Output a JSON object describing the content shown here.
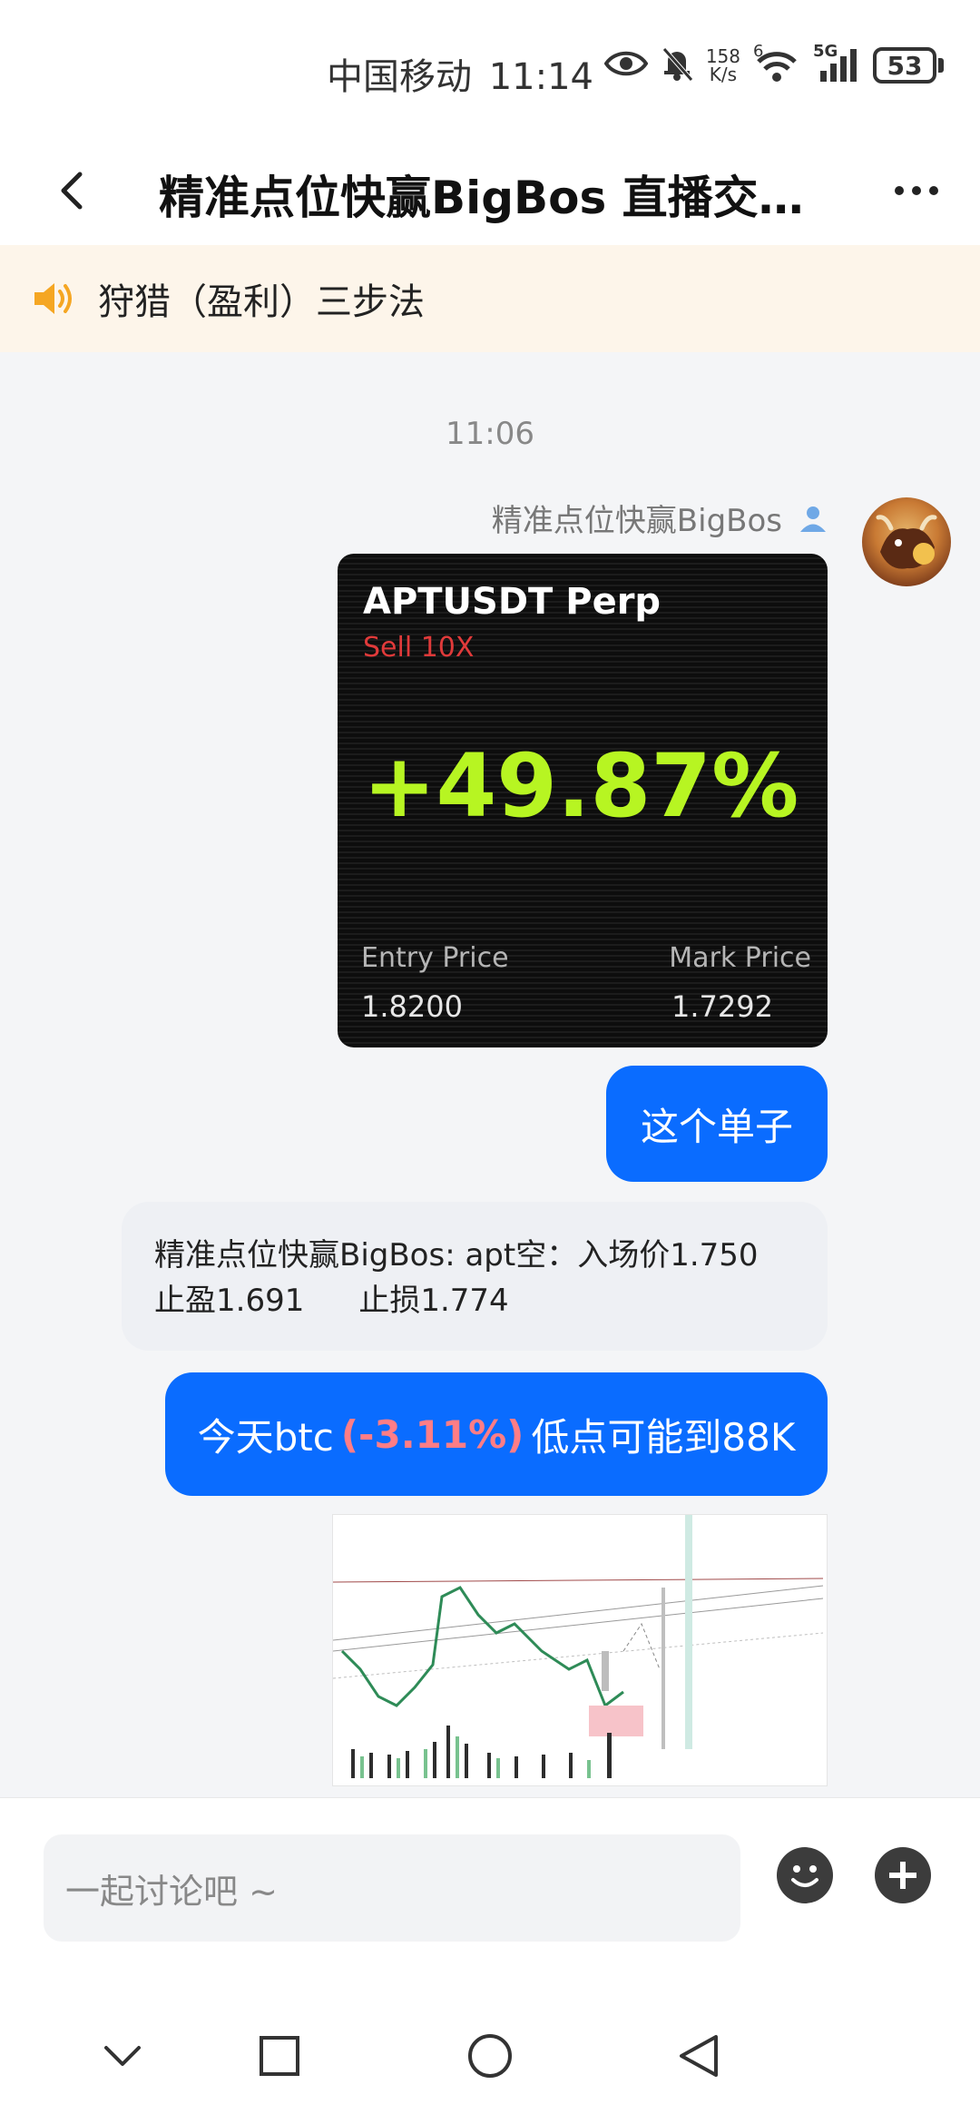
{
  "status_bar": {
    "carrier": "中国移动",
    "time": "11:14",
    "net_speed_value": "158",
    "net_speed_unit": "K/s",
    "wifi_badge": "6",
    "cell_label": "5G",
    "battery": "53"
  },
  "header": {
    "title": "精准点位快赢BigBos 直播交…"
  },
  "announcement": {
    "text": "狩猎（盈利）三步法"
  },
  "chat": {
    "timestamp": "11:06",
    "sender_name": "精准点位快赢BigBos",
    "trade_card": {
      "pair": "APTUSDT Perp",
      "side": "Sell  10X",
      "pnl": "+49.87%",
      "entry_label": "Entry Price",
      "entry_value": "1.8200",
      "mark_label": "Mark Price",
      "mark_value": "1.7292"
    },
    "msg1": "这个单子",
    "quote_line1": "精准点位快赢BigBos: apt空：入场价1.750",
    "quote_tp": "止盈1.691",
    "quote_sl": "止损1.774",
    "msg2_prefix": "今天btc",
    "msg2_highlight": "(-3.11%)",
    "msg2_suffix": "低点可能到88K"
  },
  "input": {
    "placeholder": "一起讨论吧 ~"
  },
  "colors": {
    "accent_blue": "#0a6cff",
    "pnl_green": "#b7f522",
    "sell_red": "#e03a3a",
    "announcement_bg": "#fdf5ea"
  },
  "icons": [
    "eye-icon",
    "bell-muted-icon",
    "wifi-icon",
    "signal-icon",
    "back-icon",
    "more-icon",
    "speaker-icon",
    "user-icon",
    "emoji-icon",
    "plus-icon",
    "nav-down-icon",
    "nav-square-icon",
    "nav-circle-icon",
    "nav-back-icon"
  ]
}
